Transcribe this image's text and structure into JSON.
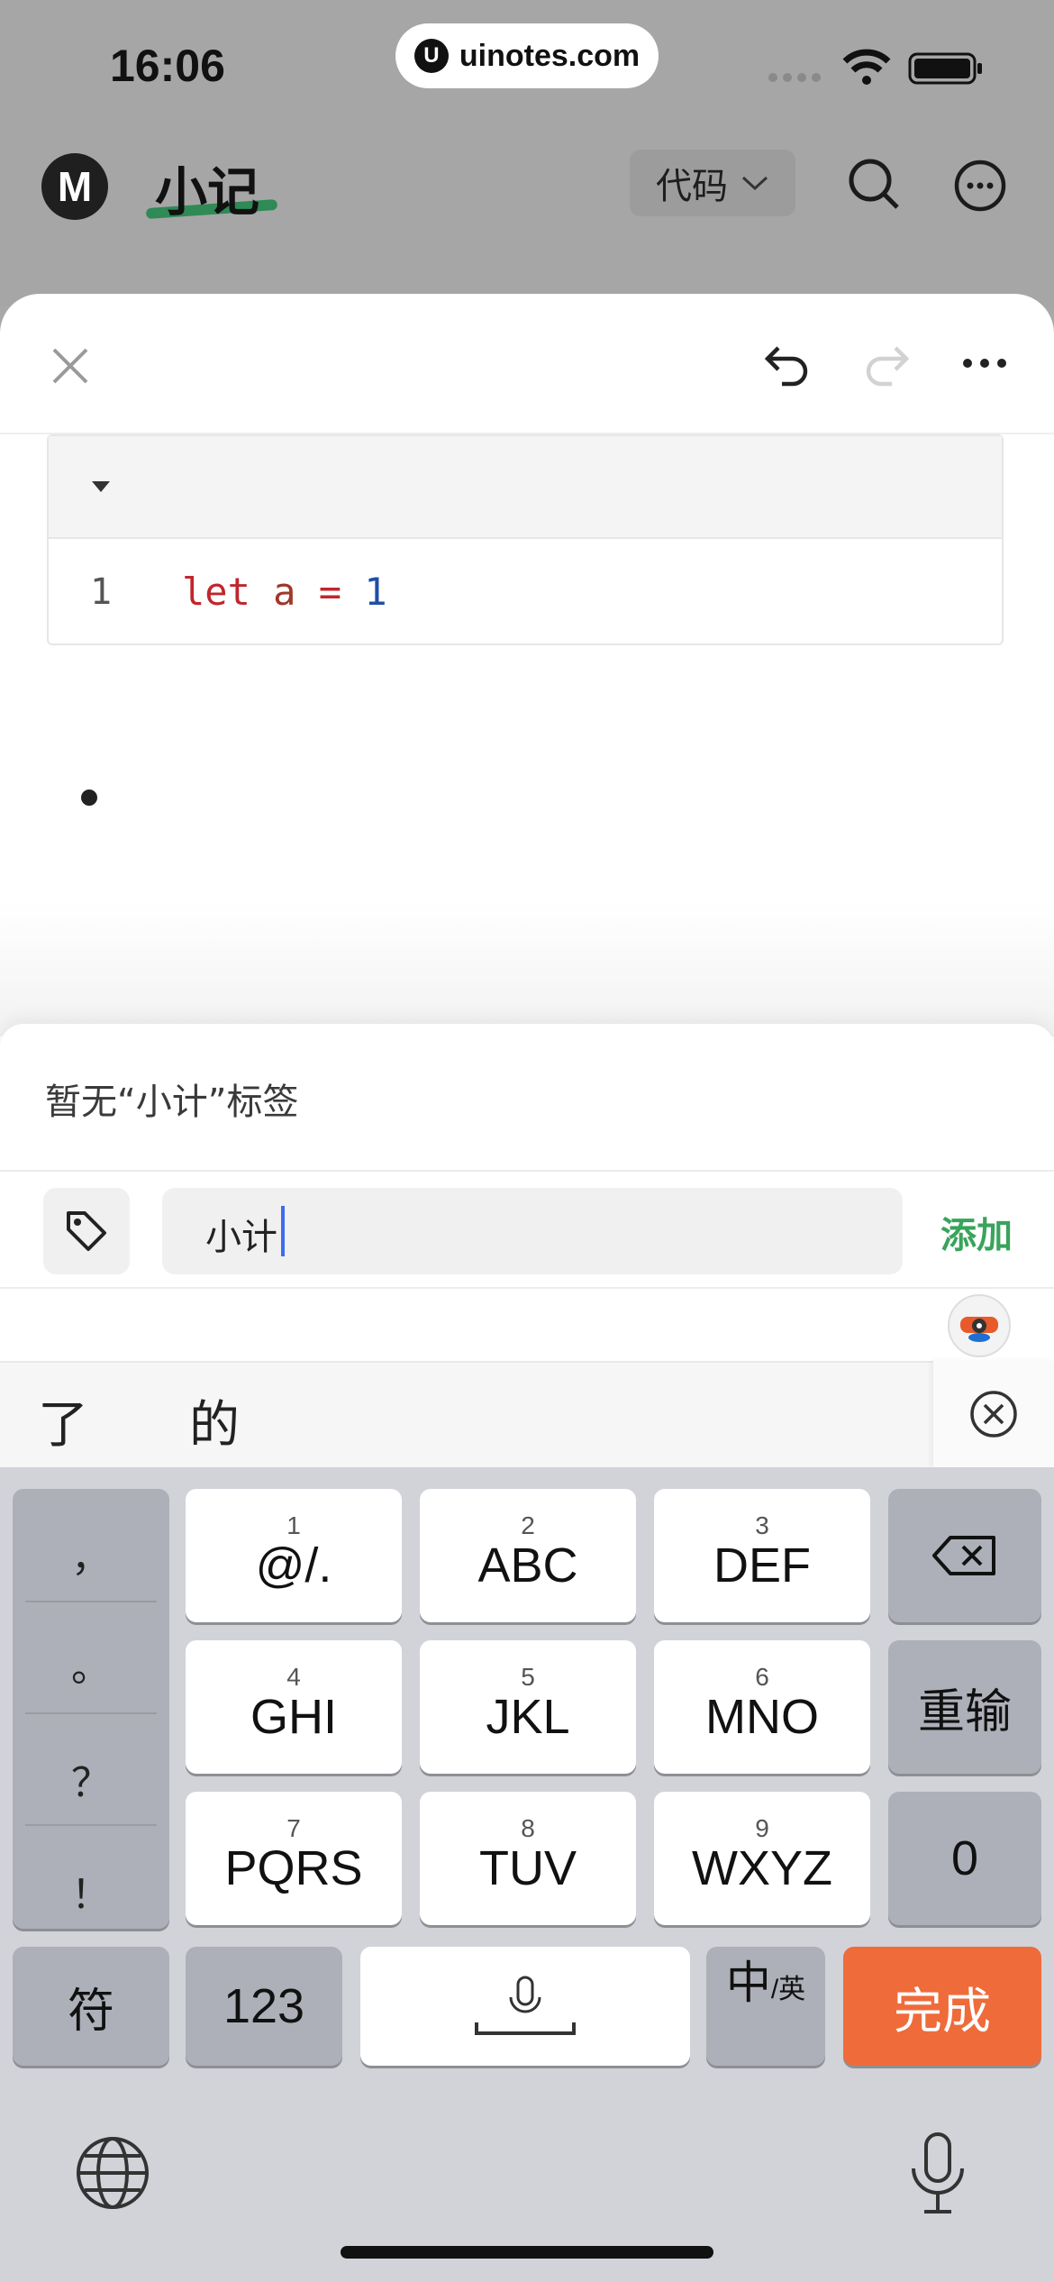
{
  "status_bar": {
    "time": "16:06",
    "site": "uinotes.com"
  },
  "app_header": {
    "logo": "M",
    "title": "小记",
    "mode_label": "代码"
  },
  "editor": {
    "code_line_number": "1",
    "code": {
      "keyword": "let",
      "var": "a",
      "op": "=",
      "num": "1"
    }
  },
  "tag_panel": {
    "empty_hint": "暂无“小计”标签",
    "input_value": "小计",
    "add_label": "添加"
  },
  "candidates": [
    "了",
    "的"
  ],
  "keyboard": {
    "punct": [
      "，",
      "。",
      "？",
      "！"
    ],
    "keys": [
      {
        "num": "1",
        "label": "@/."
      },
      {
        "num": "2",
        "label": "ABC"
      },
      {
        "num": "3",
        "label": "DEF"
      },
      {
        "num": "4",
        "label": "GHI"
      },
      {
        "num": "5",
        "label": "JKL"
      },
      {
        "num": "6",
        "label": "MNO"
      },
      {
        "num": "7",
        "label": "PQRS"
      },
      {
        "num": "8",
        "label": "TUV"
      },
      {
        "num": "9",
        "label": "WXYZ"
      }
    ],
    "reinput_label": "重输",
    "zero_label": "0",
    "symbol_label": "符",
    "num_label": "123",
    "lang_main": "中",
    "lang_sub": "/英",
    "done_label": "完成"
  },
  "colors": {
    "accent_green": "#3aa35c",
    "done_orange": "#ef6b3a",
    "caret": "#3c6cf0"
  }
}
